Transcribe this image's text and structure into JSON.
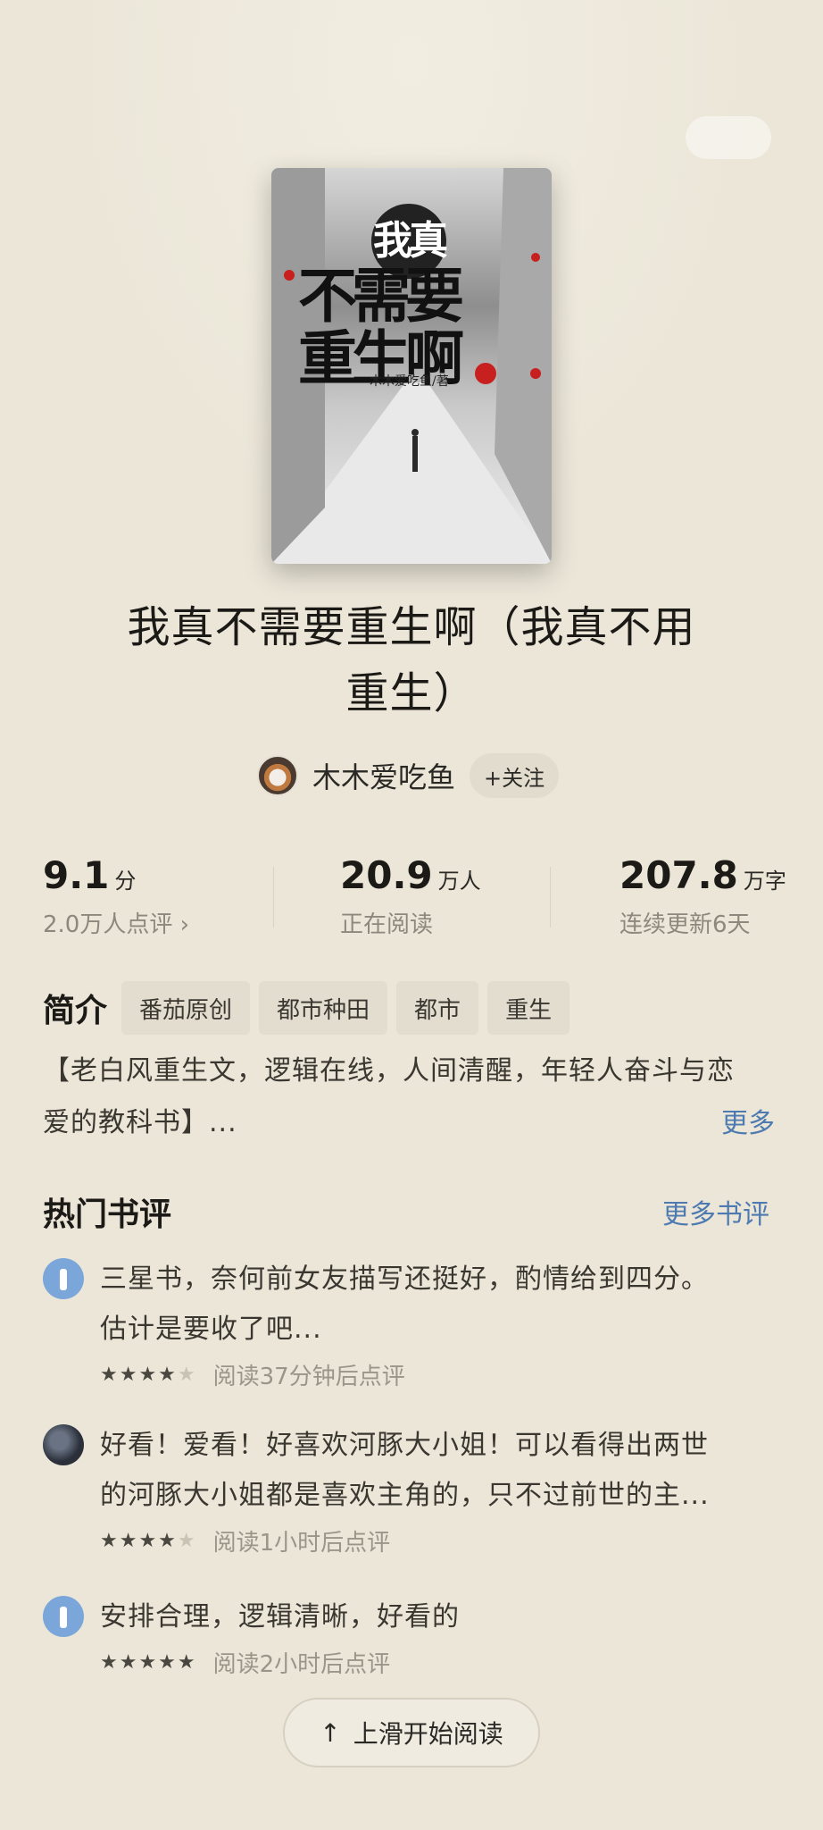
{
  "book": {
    "cover_title_line1": "我真",
    "cover_title_line2": "不需要",
    "cover_title_line3": "重生啊",
    "cover_author": "木木爱吃鱼/著",
    "title_line1": "我真不需要重生啊（我真不用",
    "title_line2": "重生）"
  },
  "author": {
    "name": "木木爱吃鱼",
    "follow_label": "+关注"
  },
  "stats": {
    "rating": {
      "value": "9.1",
      "unit": "分",
      "sub": "2.0万人点评 ›"
    },
    "readers": {
      "value": "20.9",
      "unit": "万人",
      "sub": "正在阅读"
    },
    "words": {
      "value": "207.8",
      "unit": "万字",
      "sub": "连续更新6天"
    }
  },
  "intro": {
    "label": "简介",
    "tags": [
      "番茄原创",
      "都市种田",
      "都市",
      "重生"
    ],
    "text_line1": "【老白风重生文，逻辑在线，人间清醒，年轻人奋斗与恋",
    "text_line2": "爱的教科书】...",
    "more_label": "更多"
  },
  "reviews": {
    "section_title": "热门书评",
    "more_label": "更多书评",
    "items": [
      {
        "text_line1": "三星书，奈何前女友描写还挺好，酌情给到四分。",
        "text_line2": "估计是要收了吧...",
        "stars": 4,
        "time": "阅读37分钟后点评"
      },
      {
        "text_line1": "好看！爱看！好喜欢河豚大小姐！可以看得出两世",
        "text_line2": "的河豚大小姐都是喜欢主角的，只不过前世的主...",
        "stars": 4,
        "time": "阅读1小时后点评"
      },
      {
        "text_line1": "安排合理，逻辑清晰，好看的",
        "text_line2": "",
        "stars": 5,
        "time": "阅读2小时后点评"
      }
    ]
  },
  "bottom": {
    "start_label": "上滑开始阅读",
    "arrow_icon": "arrow-up-icon"
  }
}
